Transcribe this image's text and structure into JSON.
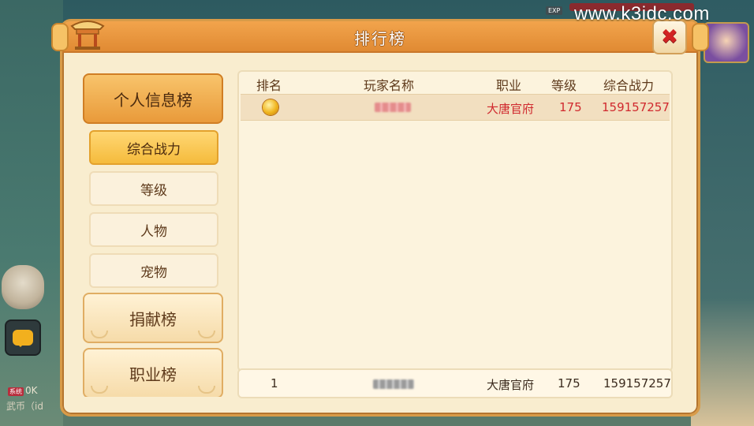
{
  "watermark": "www.k3idc.com",
  "hud": {
    "exp_label": "EXP",
    "left_tag": "系统",
    "left_line1": "0K",
    "left_line2": "武币（id"
  },
  "window": {
    "title": "排行榜"
  },
  "sidebar": {
    "categories": [
      {
        "label": "个人信息榜",
        "active": true
      },
      {
        "label": "捐献榜",
        "active": false
      },
      {
        "label": "职业榜",
        "active": false
      }
    ],
    "subcategories": [
      {
        "label": "综合战力",
        "active": true
      },
      {
        "label": "等级",
        "active": false
      },
      {
        "label": "人物",
        "active": false
      },
      {
        "label": "宠物",
        "active": false
      }
    ]
  },
  "table": {
    "headers": {
      "rank": "排名",
      "name": "玩家名称",
      "job": "职业",
      "level": "等级",
      "power": "综合战力"
    },
    "rows": [
      {
        "rank_icon": "gold-medal-icon",
        "name": "",
        "job": "大唐官府",
        "level": "175",
        "power": "159157257"
      }
    ]
  },
  "my_rank": {
    "rank": "1",
    "name": "",
    "job": "大唐官府",
    "level": "175",
    "power": "159157257"
  },
  "colors": {
    "accent": "#e99a3a",
    "highlight_text": "#d0292e",
    "panel_bg": "#f9edcf"
  }
}
